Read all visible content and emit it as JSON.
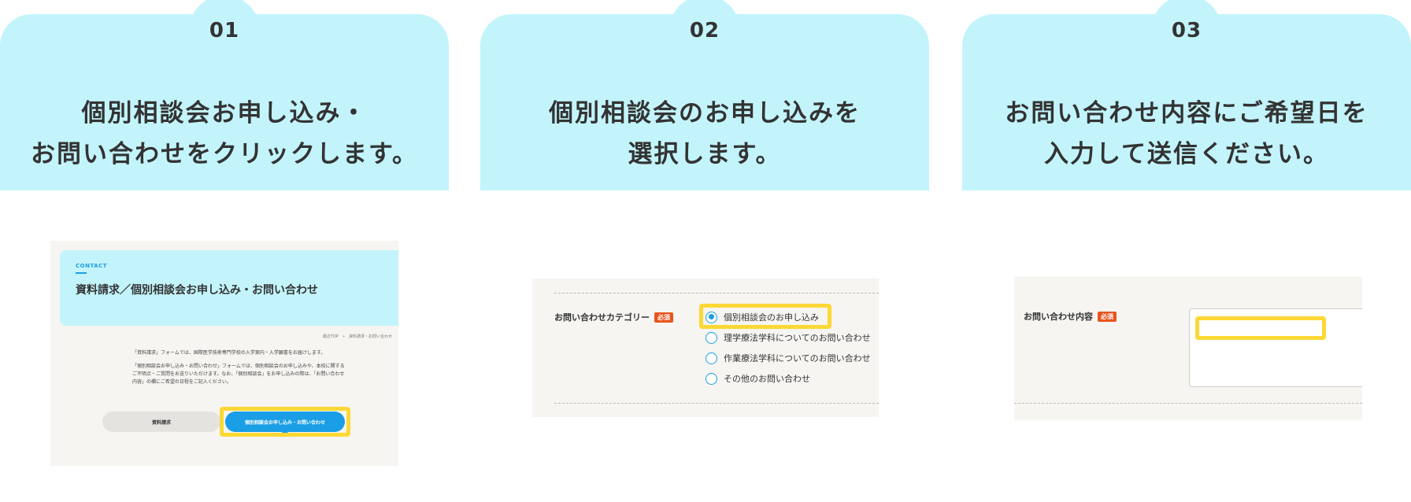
{
  "steps": [
    {
      "number": "01",
      "title_lines": [
        "個別相談会お申し込み・",
        "お問い合わせをクリックします。"
      ],
      "screenshot": {
        "eyebrow": "CONTACT",
        "heading": "資料請求／個別相談会お申し込み・お問い合わせ",
        "breadcrumb": "最近TOP　»　資料請求・お問い合わせ",
        "paragraphs": [
          "「資料請求」フォームでは、国際医学技術専門学校の入学案内・入学願書をお届けします。",
          "「個別相談会お申し込み・お問い合わせ」フォームでは、個別相談会のお申し込みや、本校に関するご不明点・ご質問をお送りいただけます。なお、「個別相談会」をお申し込みの際は、「お問い合わせ内容」の欄にご希望の日程をご記入ください。"
        ],
        "button_gray": "資料請求",
        "button_blue": "個別相談会お申し込み・お問い合わせ"
      }
    },
    {
      "number": "02",
      "title_lines": [
        "個別相談会のお申し込みを",
        "選択します。"
      ],
      "screenshot": {
        "label": "お問い合わせカテゴリー",
        "required": "必須",
        "options": [
          {
            "label": "個別相談会のお申し込み",
            "checked": true
          },
          {
            "label": "理学療法学科についてのお問い合わせ",
            "checked": false
          },
          {
            "label": "作業療法学科についてのお問い合わせ",
            "checked": false
          },
          {
            "label": "その他のお問い合わせ",
            "checked": false
          }
        ]
      }
    },
    {
      "number": "03",
      "title_lines": [
        "お問い合わせ内容にご希望日を",
        "入力して送信ください。"
      ],
      "screenshot": {
        "label": "お問い合わせ内容",
        "required": "必須",
        "textarea_value": ""
      }
    }
  ],
  "colors": {
    "header_bg": "#c3f4fb",
    "accent_blue": "#1a9ee6",
    "highlight_yellow": "#fdd835",
    "required_badge": "#e8541e",
    "screenshot_bg": "#f6f5f1"
  }
}
